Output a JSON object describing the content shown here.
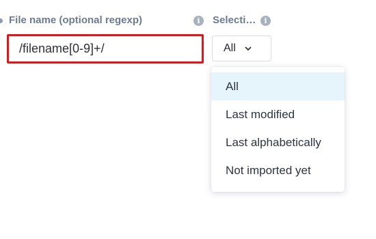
{
  "file_name": {
    "label": "File name (optional regexp)",
    "value": "/filename[0-9]+/"
  },
  "selection": {
    "label": "Selecti…",
    "current": "All",
    "options": [
      "All",
      "Last modified",
      "Last alphabetically",
      "Not imported yet"
    ],
    "active_index": 0
  },
  "icons": {
    "info": "i"
  },
  "colors": {
    "label": "#6c7a93",
    "focus_border": "#e0161c",
    "active_option_bg": "#e6f4fb",
    "info_icon": "#a7b1c2"
  }
}
